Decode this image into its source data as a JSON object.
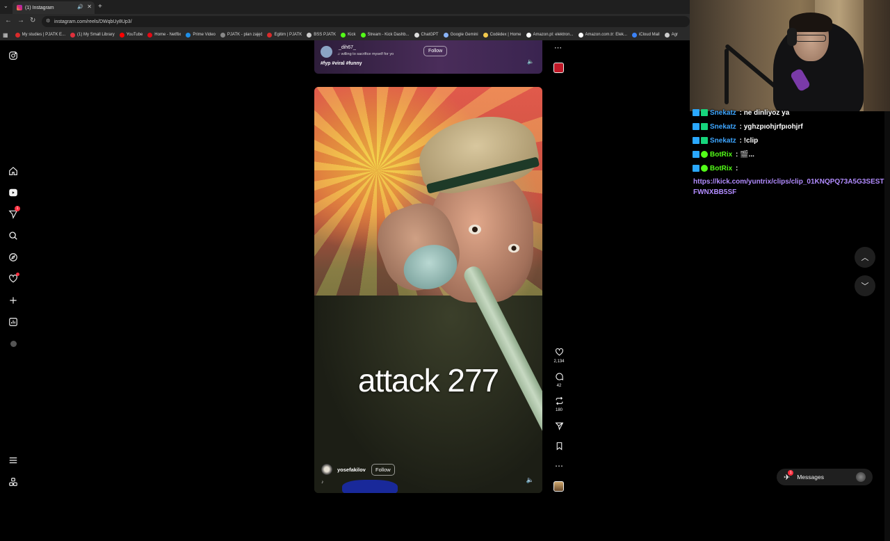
{
  "browser": {
    "tab_title": "(1) Instagram",
    "url": "instagram.com/reels/DWqbUy8Up3/",
    "bookmarks": [
      {
        "label": "My studies | PJATK E...",
        "color": "#d92b2b"
      },
      {
        "label": "(1) My Small Library",
        "color": "#e0303c"
      },
      {
        "label": "YouTube",
        "color": "#ff0000"
      },
      {
        "label": "Home - Netflix",
        "color": "#e50914"
      },
      {
        "label": "Prime Video",
        "color": "#1f8fe8"
      },
      {
        "label": "PJATK - plan zajęć",
        "color": "#888888"
      },
      {
        "label": "Egitim | PJATK",
        "color": "#d92b2b"
      },
      {
        "label": "BSS PJATK",
        "color": "#cccccc"
      },
      {
        "label": "Kick",
        "color": "#53fc18"
      },
      {
        "label": "Stream - Kick Dashb...",
        "color": "#53fc18"
      },
      {
        "label": "ChatGPT",
        "color": "#dddddd"
      },
      {
        "label": "Google Gemini",
        "color": "#8ab4f8"
      },
      {
        "label": "Codédex | Home",
        "color": "#f2c94c"
      },
      {
        "label": "Amazon.pl: elektron...",
        "color": "#ffffff"
      },
      {
        "label": "Amazon.com.tr: Elek...",
        "color": "#ffffff"
      },
      {
        "label": "iCloud Mail",
        "color": "#3b82f6"
      },
      {
        "label": "Agr",
        "color": "#cccccc"
      }
    ]
  },
  "sidenav": {
    "notification_count": "1"
  },
  "prev_reel": {
    "username": "_dih67_",
    "audio": "willing to sacrifice myself for yo",
    "follow_label": "Follow",
    "tags": "#fyp #viral #funny"
  },
  "reel": {
    "caption": "attack 277",
    "username": "yosefakilov",
    "follow_label": "Follow",
    "likes": "2,134",
    "comments": "42",
    "reposts": "180"
  },
  "messages": {
    "label": "Messages",
    "badge": "1"
  },
  "chat": [
    {
      "user": "Snekatz",
      "user_color": "#3ea6ff",
      "text": "ne dinliyoz ya"
    },
    {
      "user": "Snekatz",
      "user_color": "#3ea6ff",
      "text": "yghzpıohjrfpıohjrf"
    },
    {
      "user": "Snekatz",
      "user_color": "#3ea6ff",
      "text": "!clip"
    },
    {
      "user": "BotRix",
      "user_color": "#53fc18",
      "text": "🎬..."
    },
    {
      "user": "BotRix",
      "user_color": "#53fc18",
      "text": ""
    }
  ],
  "chat_link": "https://kick.com/yuntrix/clips/clip_01KNQPQ73A5G3SESTFWNXBB5SF"
}
